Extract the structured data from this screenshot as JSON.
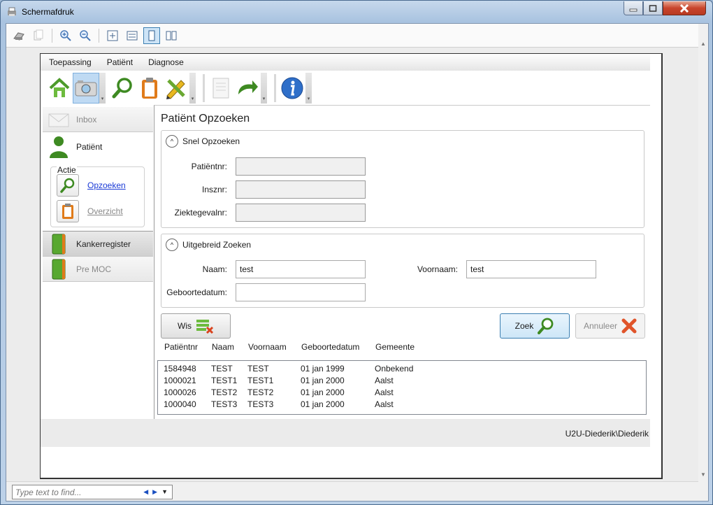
{
  "window": {
    "title": "Schermafdruk"
  },
  "viewer_toolbar": {
    "icons": [
      "print-icon",
      "copy-icon",
      "zoom-in-icon",
      "zoom-out-icon",
      "fit-page-icon",
      "fit-width-icon",
      "single-page-icon",
      "two-page-icon"
    ],
    "active": "single-page-icon"
  },
  "menu": {
    "items": [
      "Toepassing",
      "Patiënt",
      "Diagnose"
    ]
  },
  "sidebar": {
    "inbox": "Inbox",
    "patient": "Patiënt",
    "actie_label": "Actie",
    "actions": [
      {
        "label": "Opzoeken"
      },
      {
        "label": "Overzicht"
      }
    ],
    "kankerregister": "Kankerregister",
    "premoc": "Pre MOC"
  },
  "content": {
    "title": "Patiënt Opzoeken",
    "snel": {
      "header": "Snel Opzoeken",
      "fields": [
        {
          "label": "Patiëntnr:",
          "value": ""
        },
        {
          "label": "Insznr:",
          "value": ""
        },
        {
          "label": "Ziektegevalnr:",
          "value": ""
        }
      ]
    },
    "uitgebreid": {
      "header": "Uitgebreid Zoeken",
      "naam_label": "Naam:",
      "naam_value": "test",
      "voornaam_label": "Voornaam:",
      "voornaam_value": "test",
      "geboorte_label": "Geboortedatum:",
      "geboorte_value": ""
    },
    "buttons": {
      "wis": "Wis",
      "zoek": "Zoek",
      "annuleer": "Annuleer"
    },
    "table": {
      "columns": [
        "Patiëntnr",
        "Naam",
        "Voornaam",
        "Geboortedatum",
        "Gemeente"
      ],
      "rows": [
        [
          "1584948",
          "TEST",
          "TEST",
          "01 jan 1999",
          "Onbekend"
        ],
        [
          "1000021",
          "TEST1",
          "TEST1",
          "01 jan 2000",
          "Aalst"
        ],
        [
          "1000026",
          "TEST2",
          "TEST2",
          "01 jan 2000",
          "Aalst"
        ],
        [
          "1000040",
          "TEST3",
          "TEST3",
          "01 jan 2000",
          "Aalst"
        ]
      ]
    }
  },
  "status": {
    "user": "U2U-Diederik\\Diederik"
  },
  "find": {
    "placeholder": "Type text to find..."
  }
}
